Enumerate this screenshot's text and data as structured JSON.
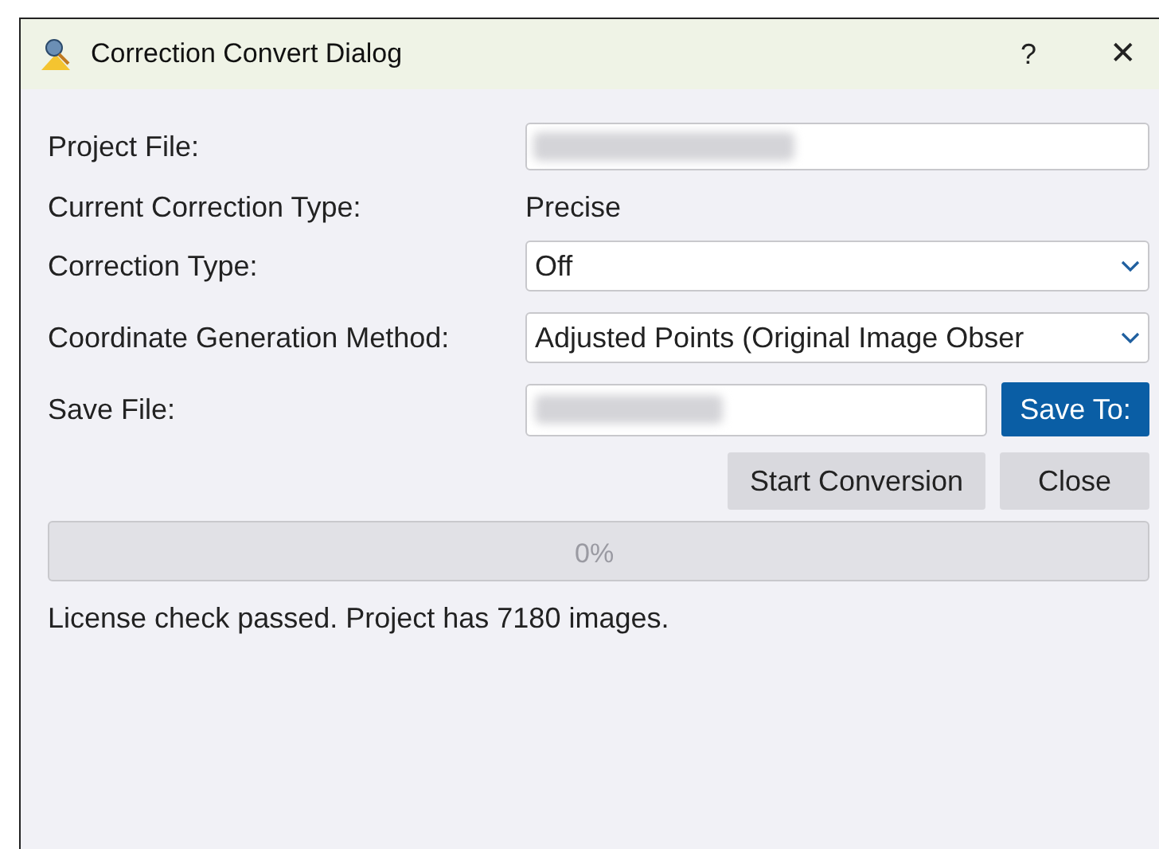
{
  "window": {
    "title": "Correction Convert Dialog",
    "help": "?",
    "close": "✕"
  },
  "form": {
    "project_file_label": "Project File:",
    "current_type_label": "Current Correction Type:",
    "current_type_value": "Precise",
    "correction_type_label": "Correction Type:",
    "correction_type_value": "Off",
    "method_label": "Coordinate Generation Method:",
    "method_value": "Adjusted Points (Original Image Obser",
    "save_file_label": "Save File:"
  },
  "buttons": {
    "save_to": "Save To:",
    "start": "Start Conversion",
    "close": "Close"
  },
  "progress": {
    "level": 0,
    "reading": "0%"
  },
  "status": "License check passed. Project has 7180 images."
}
